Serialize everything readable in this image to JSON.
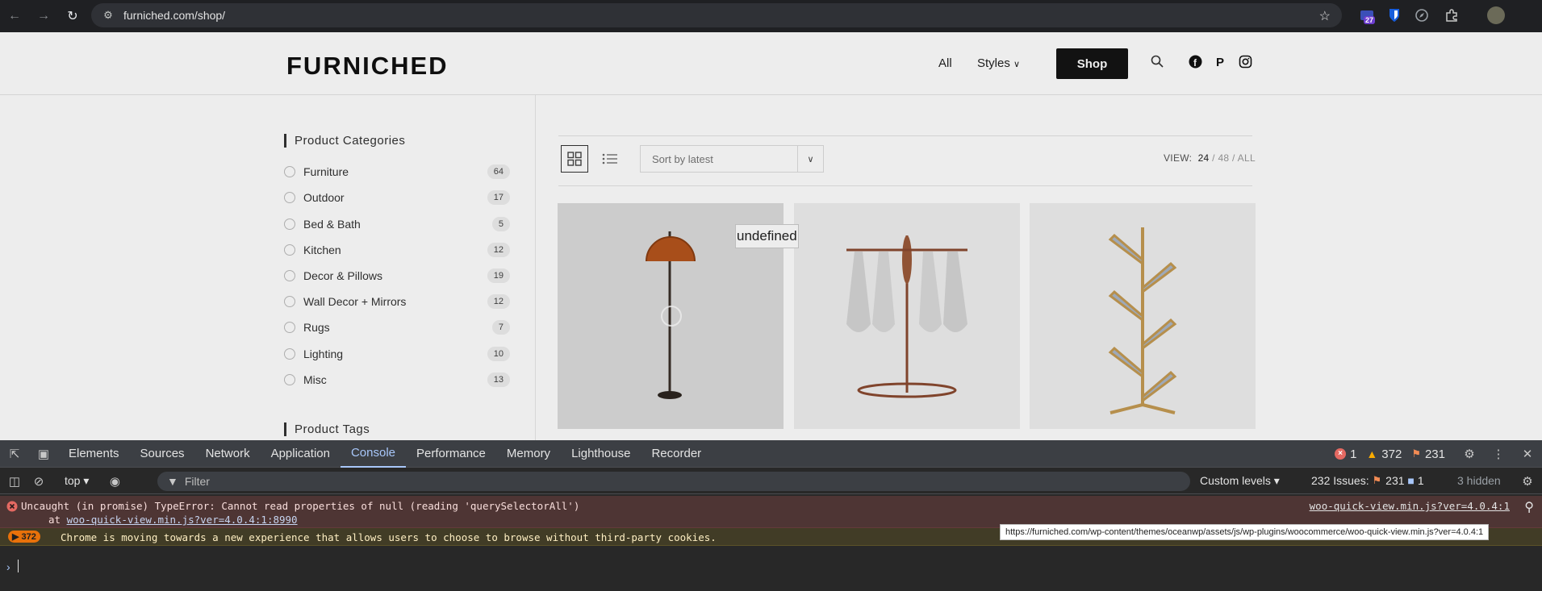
{
  "browser": {
    "url": "furniched.com/shop/",
    "extension_badge": "27"
  },
  "site": {
    "logo": "FURNICHED",
    "menu": {
      "all": "All",
      "styles": "Styles",
      "shop": "Shop"
    }
  },
  "sidebar": {
    "categories_title": "Product Categories",
    "categories": [
      {
        "label": "Furniture",
        "count": "64"
      },
      {
        "label": "Outdoor",
        "count": "17"
      },
      {
        "label": "Bed & Bath",
        "count": "5"
      },
      {
        "label": "Kitchen",
        "count": "12"
      },
      {
        "label": "Decor & Pillows",
        "count": "19"
      },
      {
        "label": "Wall Decor + Mirrors",
        "count": "12"
      },
      {
        "label": "Rugs",
        "count": "7"
      },
      {
        "label": "Lighting",
        "count": "10"
      },
      {
        "label": "Misc",
        "count": "13"
      }
    ],
    "tags_title": "Product Tags"
  },
  "toolbar": {
    "sort": "Sort by latest",
    "view_label": "VIEW:",
    "view_24": "24",
    "view_48": "48",
    "view_all": "ALL",
    "sep": "/"
  },
  "overlay_text": "undefined",
  "devtools": {
    "tabs": [
      "Elements",
      "Sources",
      "Network",
      "Application",
      "Console",
      "Performance",
      "Memory",
      "Lighthouse",
      "Recorder"
    ],
    "active_tab": "Console",
    "error_count": "1",
    "warning_count": "372",
    "issue_count": "231",
    "context": "top",
    "filter_placeholder": "Filter",
    "levels": "Custom levels",
    "issues_label": "232 Issues:",
    "issues_flag": "231",
    "issues_info": "1",
    "hidden": "3 hidden",
    "error_message": "Uncaught (in promise) TypeError: Cannot read properties of null (reading 'querySelectorAll')",
    "error_at": "at",
    "error_stack_link": "woo-quick-view.min.js?ver=4.0.4:1:8990",
    "error_source": "woo-quick-view.min.js?ver=4.0.4:1",
    "tooltip": "https://furniched.com/wp-content/themes/oceanwp/assets/js/wp-plugins/woocommerce/woo-quick-view.min.js?ver=4.0.4:1",
    "warn_count_badge": "372",
    "warn_message": "Chrome is moving towards a new experience that allows users to choose to browse without third-party cookies."
  },
  "colors": {
    "devtools_bg": "#282828",
    "error_bg": "#4e3534",
    "warn_bg": "#413c26",
    "accent": "#a8c7fa"
  }
}
